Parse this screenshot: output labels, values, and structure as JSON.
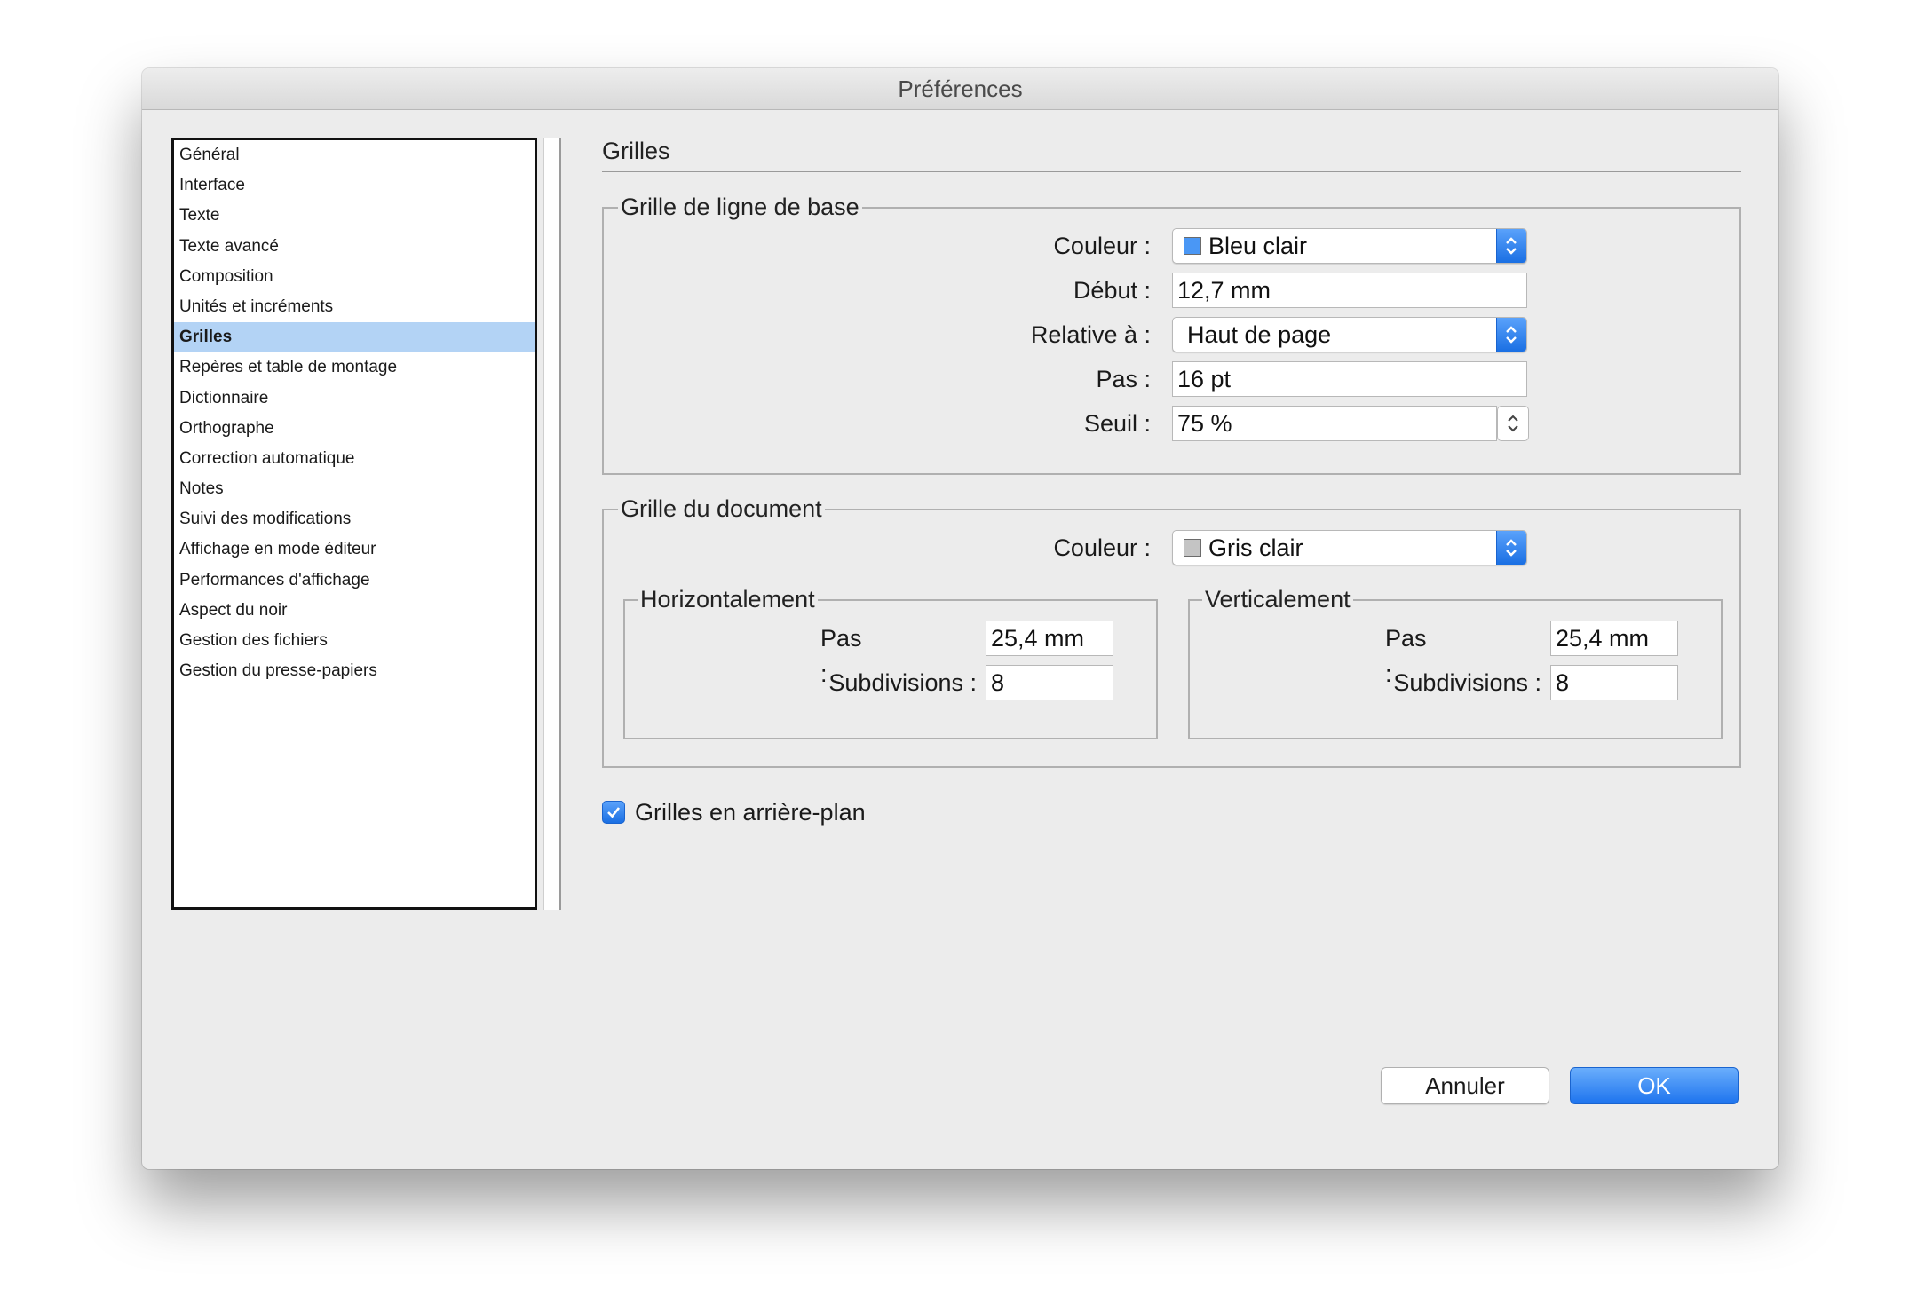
{
  "window": {
    "title": "Préférences"
  },
  "sidebar": {
    "items": [
      {
        "label": "Général"
      },
      {
        "label": "Interface"
      },
      {
        "label": "Texte"
      },
      {
        "label": "Texte avancé"
      },
      {
        "label": "Composition"
      },
      {
        "label": "Unités et incréments"
      },
      {
        "label": "Grilles",
        "selected": true
      },
      {
        "label": "Repères et table de montage"
      },
      {
        "label": "Dictionnaire"
      },
      {
        "label": "Orthographe"
      },
      {
        "label": "Correction automatique"
      },
      {
        "label": "Notes"
      },
      {
        "label": "Suivi des modifications"
      },
      {
        "label": "Affichage en mode éditeur"
      },
      {
        "label": "Performances d'affichage"
      },
      {
        "label": "Aspect du noir"
      },
      {
        "label": "Gestion des fichiers"
      },
      {
        "label": "Gestion du presse-papiers"
      }
    ]
  },
  "section": {
    "title": "Grilles"
  },
  "baseline_grid": {
    "title": "Grille de ligne de base",
    "color_label": "Couleur :",
    "color_value": "Bleu clair",
    "color_swatch": "#4a97f5",
    "start_label": "Début :",
    "start_value": "12,7 mm",
    "relative_label": "Relative à :",
    "relative_value": "Haut de page",
    "step_label": "Pas :",
    "step_value": "16 pt",
    "threshold_label": "Seuil :",
    "threshold_value": "75 %"
  },
  "document_grid": {
    "title": "Grille du document",
    "color_label": "Couleur :",
    "color_value": "Gris clair",
    "color_swatch": "#c4c4c4",
    "horizontal": {
      "title": "Horizontalement",
      "step_label": "Pas :",
      "step_value": "25,4 mm",
      "subdiv_label": "Subdivisions :",
      "subdiv_value": "8"
    },
    "vertical": {
      "title": "Verticalement",
      "step_label": "Pas :",
      "step_value": "25,4 mm",
      "subdiv_label": "Subdivisions :",
      "subdiv_value": "8"
    }
  },
  "grids_in_back": {
    "label": "Grilles en arrière-plan",
    "checked": true
  },
  "buttons": {
    "cancel": "Annuler",
    "ok": "OK"
  },
  "colors": {
    "accent": "#1e74ee",
    "selection": "#b3d3f5"
  }
}
